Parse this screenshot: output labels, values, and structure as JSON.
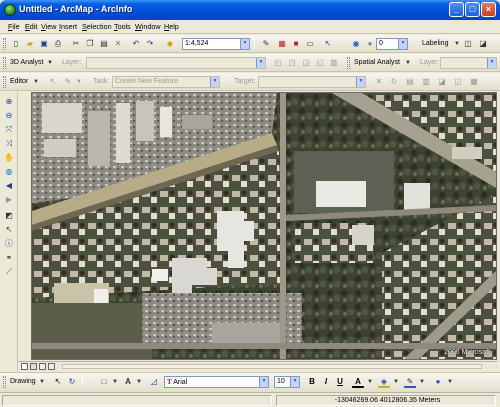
{
  "window": {
    "title": "Untitled - ArcMap - ArcInfo",
    "minimize": "_",
    "maximize": "□",
    "close": "×"
  },
  "menu": [
    "File",
    "Edit",
    "View",
    "Insert",
    "Selection",
    "Tools",
    "Window",
    "Help"
  ],
  "standard_toolbar": {
    "scale": "1:4,524",
    "value": "0",
    "labeling_label": "Labeling"
  },
  "analyst_toolbar": {
    "analyst_3d_label": "3D Analyst",
    "layer_label": "Layer:",
    "spatial_analyst_label": "Spatial Analyst",
    "spatial_layer_label": "Layer:"
  },
  "editor_toolbar": {
    "editor_label": "Editor",
    "task_label": "Task:",
    "task_value": "Create New Feature",
    "target_label": "Target:"
  },
  "map": {
    "watermark": "2006 Microsoft"
  },
  "drawing_toolbar": {
    "drawing_label": "Drawing",
    "font": "Arial",
    "font_size": "10",
    "bold": "B",
    "italic": "I",
    "underline": "U",
    "text_tool": "A"
  },
  "status": {
    "coordinates": "-13046269.06  4012806.35 Meters"
  },
  "colors": {
    "title_gradient_top": "#3d95ff",
    "title_gradient_bottom": "#0044c6",
    "chrome": "#ece9d8",
    "accent_blue": "#0a5fe0"
  }
}
